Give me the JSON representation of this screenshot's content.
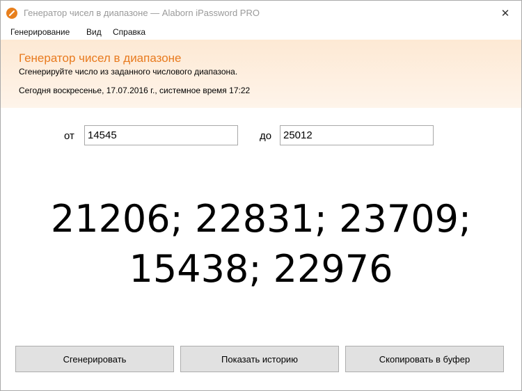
{
  "window": {
    "title": "Генератор чисел в диапазоне — Alaborn iPassword PRO",
    "close_glyph": "✕",
    "icon": "app-logo-icon",
    "accent_color": "#e87a1e"
  },
  "menu": {
    "items": [
      "Генерирование",
      "Вид",
      "Справка"
    ]
  },
  "header": {
    "title": "Генератор чисел в диапазоне",
    "subtitle": "Сгенерируйте число из заданного числового диапазона.",
    "date_line": "Сегодня воскресенье, 17.07.2016 г., системное время 17:22"
  },
  "range": {
    "from_label": "от",
    "from_value": "14545",
    "to_label": "до",
    "to_value": "25012"
  },
  "result": {
    "line1": "21206; 22831; 23709;",
    "line2": "15438; 22976"
  },
  "buttons": {
    "generate": "Сгенерировать",
    "history": "Показать историю",
    "copy": "Скопировать в буфер"
  }
}
